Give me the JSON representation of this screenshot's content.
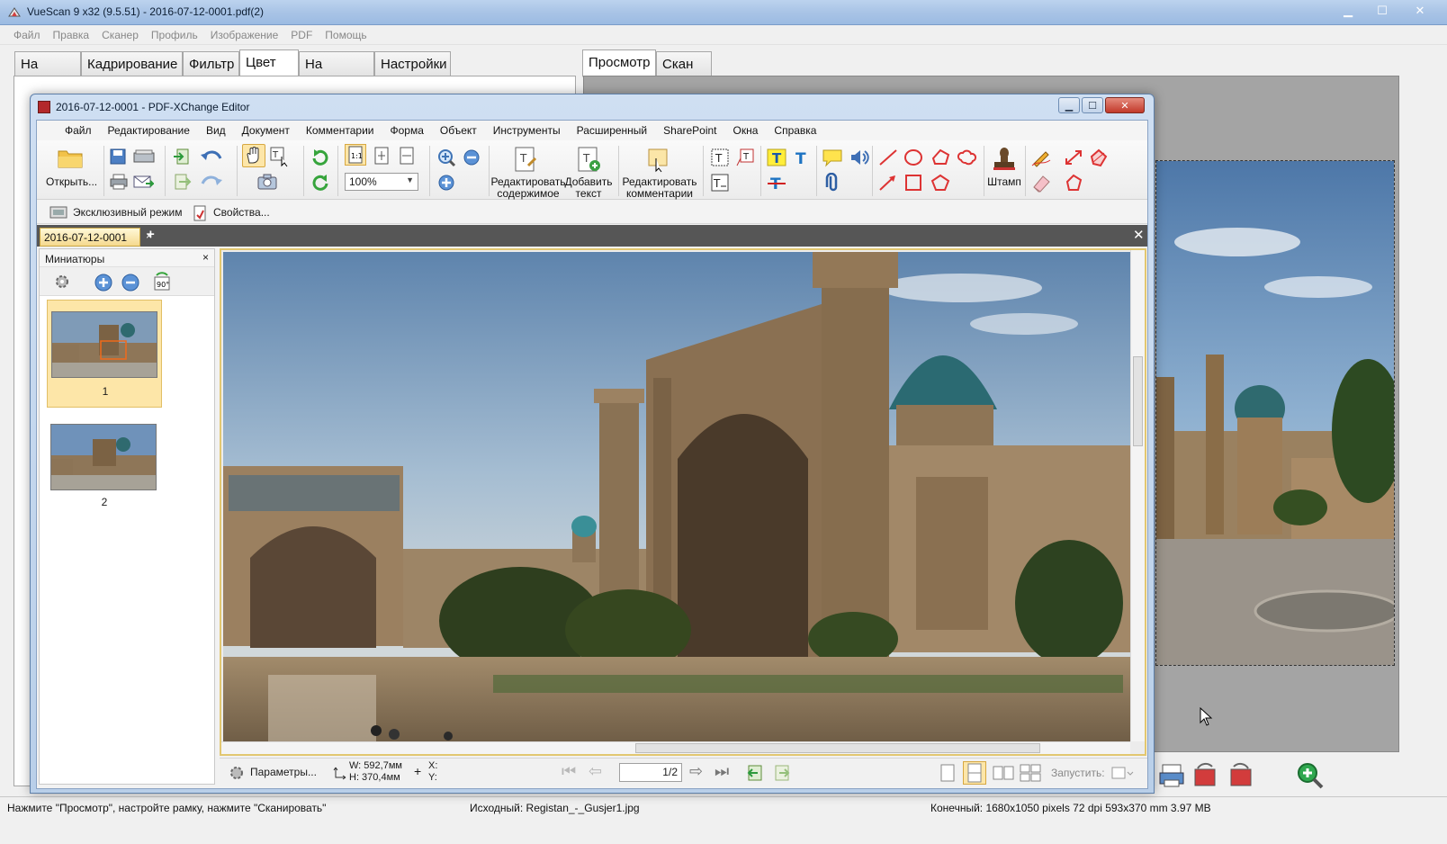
{
  "vuescan": {
    "title": "VueScan 9 x32 (9.5.51) - 2016-07-12-0001.pdf(2)",
    "menu": [
      "Файл",
      "Правка",
      "Сканер",
      "Профиль",
      "Изображение",
      "PDF",
      "Помощь"
    ],
    "left_tabs": [
      "На входе",
      "Кадрирование",
      "Фильтр",
      "Цвет",
      "На выходе",
      "Настройки"
    ],
    "active_left_tab": "Цвет",
    "right_tabs": [
      "Просмотр",
      "Скан"
    ],
    "active_right_tab": "Просмотр",
    "status": {
      "left": "Нажмите \"Просмотр\", настройте рамку, нажмите \"Сканировать\"",
      "middle": "Исходный: Registan_-_Gusjer1.jpg",
      "right": "Конечный: 1680x1050 pixels 72 dpi 593x370 mm 3.97 MB"
    }
  },
  "pdfx": {
    "title": "2016-07-12-0001 - PDF-XChange Editor",
    "menu": [
      "Файл",
      "Редактирование",
      "Вид",
      "Документ",
      "Комментарии",
      "Форма",
      "Объект",
      "Инструменты",
      "Расширенный",
      "SharePoint",
      "Окна",
      "Справка"
    ],
    "toolbar": {
      "open_label": "Открыть...",
      "zoom_value": "100%",
      "edit_content_label_1": "Редактировать",
      "edit_content_label_2": "содержимое",
      "add_text_label_1": "Добавить",
      "add_text_label_2": "текст",
      "edit_comments_label_1": "Редактировать",
      "edit_comments_label_2": "комментарии",
      "stamp_label": "Штамп"
    },
    "toolbar2": {
      "exclusive_mode": "Эксклюзивный режим",
      "properties": "Свойства..."
    },
    "doc_tab": "2016-07-12-0001",
    "thumbnails": {
      "title": "Миниатюры",
      "pages": [
        "1",
        "2"
      ],
      "selected_page": "1"
    },
    "statusbar": {
      "params_label": "Параметры...",
      "width": "W: 592,7мм",
      "height": "H: 370,4мм",
      "x": "X:",
      "y": "Y:",
      "page_current": "1",
      "page_total": "/2",
      "launch_label": "Запустить:"
    }
  },
  "colors": {
    "titlebar": "#a9c4e6",
    "accent_tab": "#f5d98e",
    "close_red": "#c2392a"
  }
}
